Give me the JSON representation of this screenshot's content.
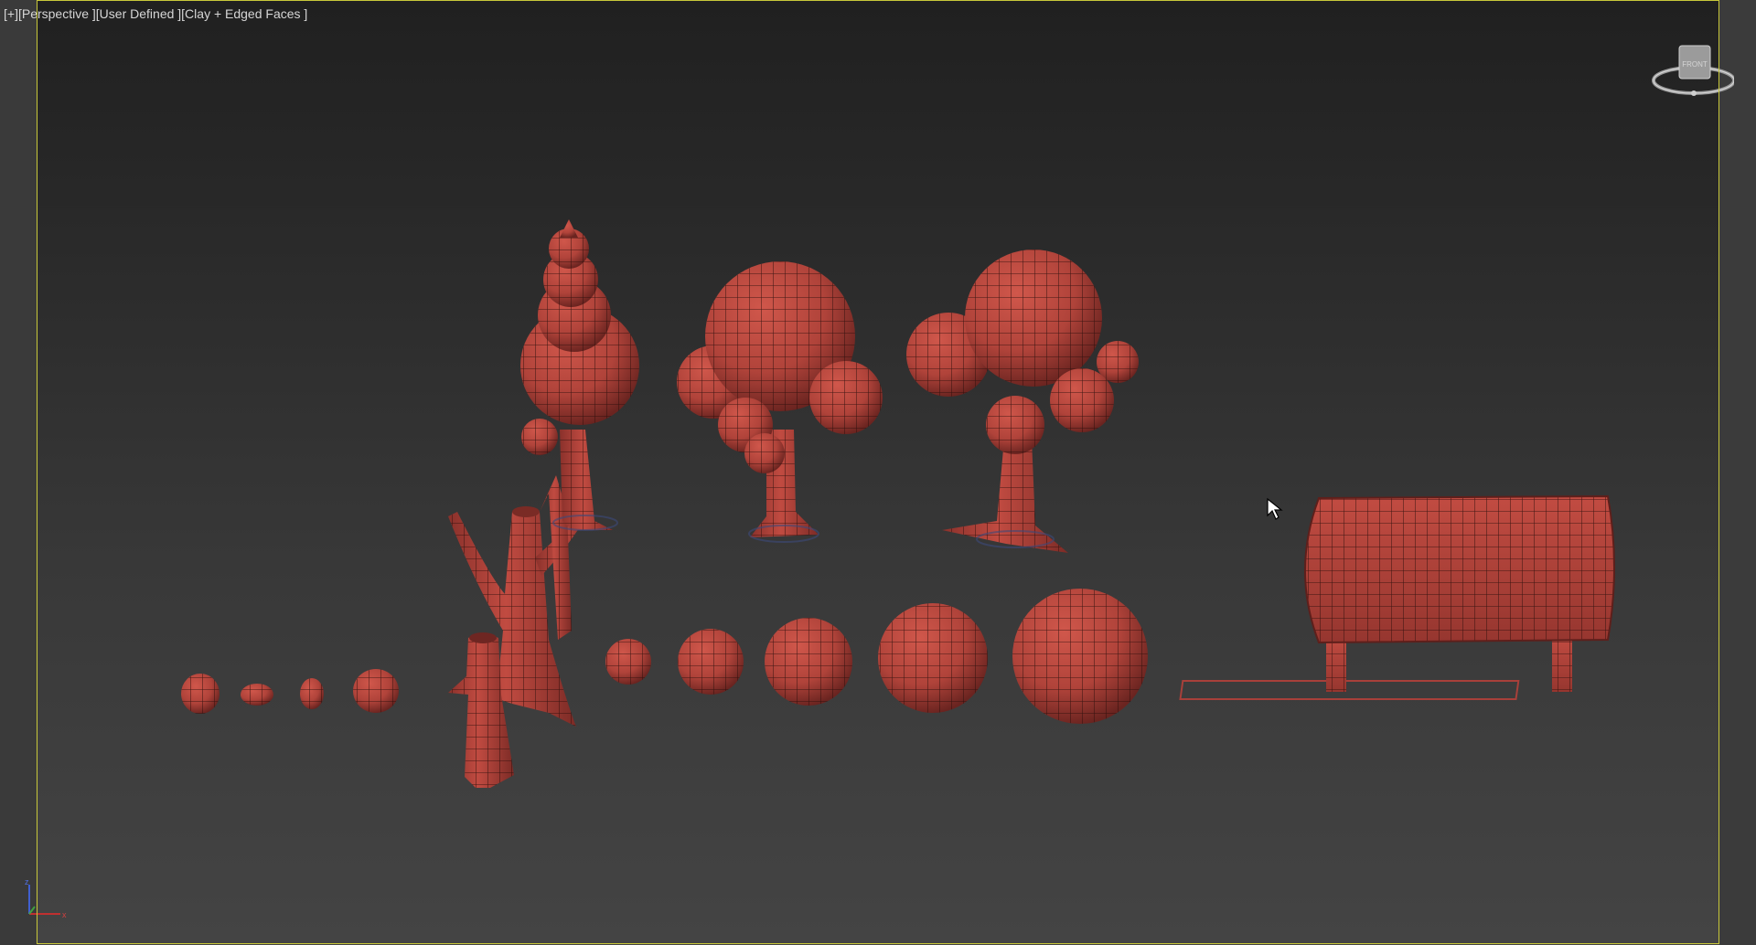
{
  "viewport": {
    "label_plus": "[+]",
    "label_view": "[Perspective ]",
    "label_camera": "[User Defined ]",
    "label_shading": "[Clay + Edged Faces ]",
    "frame_color": "#c8c83a",
    "mesh_color": "#b6453b"
  },
  "viewcube": {
    "face_label": "FRONT",
    "icon": "viewcube-icon"
  },
  "axis_tripod": {
    "x_label": "x",
    "y_label": "y",
    "z_label": "z"
  },
  "scene_objects": [
    "rock-1",
    "rock-2",
    "rock-3",
    "rock-4",
    "tree-stump",
    "dead-tree",
    "tree-conifer",
    "tree-round-1",
    "tree-round-2",
    "bush-1",
    "bush-2",
    "bush-3",
    "bush-4",
    "bush-5",
    "sign-board"
  ]
}
